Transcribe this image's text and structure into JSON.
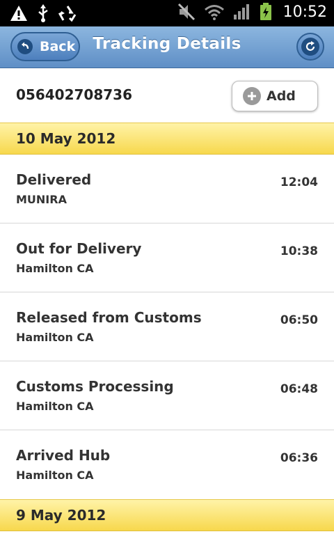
{
  "status_bar": {
    "time": "10:52",
    "icons": [
      "warning-icon",
      "usb-icon",
      "recycle-icon",
      "mute-icon",
      "wifi-icon",
      "signal-icon",
      "battery-charging-icon"
    ]
  },
  "nav": {
    "back_label": "Back",
    "title": "Tracking Details",
    "refresh_icon": "refresh-icon"
  },
  "tracking": {
    "number": "056402708736",
    "add_label": "Add"
  },
  "groups": [
    {
      "date": "10 May 2012",
      "events": [
        {
          "title": "Delivered",
          "location": "MUNIRA",
          "time": "12:04"
        },
        {
          "title": "Out for Delivery",
          "location": "Hamilton CA",
          "time": "10:38"
        },
        {
          "title": "Released from Customs",
          "location": "Hamilton CA",
          "time": "06:50"
        },
        {
          "title": "Customs Processing",
          "location": "Hamilton CA",
          "time": "06:48"
        },
        {
          "title": "Arrived Hub",
          "location": "Hamilton CA",
          "time": "06:36"
        }
      ]
    },
    {
      "date": "9 May 2012",
      "events": []
    }
  ],
  "colors": {
    "nav_blue": "#6f9fd3",
    "date_yellow": "#f7d84d"
  }
}
